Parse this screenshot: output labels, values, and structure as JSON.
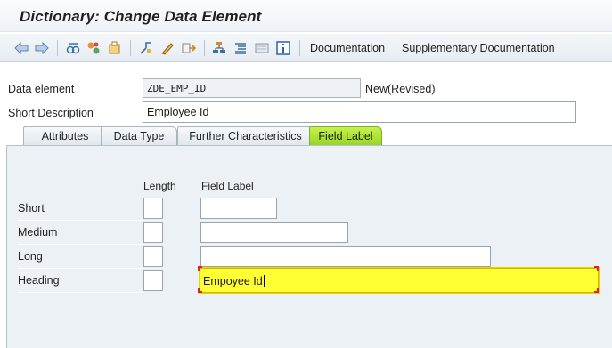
{
  "window": {
    "title": "Dictionary: Change Data Element"
  },
  "toolbar": {
    "icons": [
      "back-arrow-icon",
      "forward-arrow-icon",
      "other-object-icon",
      "display-change-icon",
      "activate-icon",
      "where-used-icon",
      "edit-object-icon",
      "navigate-icon",
      "hierarchy-icon",
      "indent-icon",
      "screen-icon",
      "info-icon"
    ],
    "documentation_label": "Documentation",
    "supplementary_label": "Supplementary Documentation"
  },
  "form": {
    "data_element_label": "Data element",
    "data_element_value": "ZDE_EMP_ID",
    "status": "New(Revised)",
    "short_description_label": "Short Description",
    "short_description_value": "Employee Id"
  },
  "tabs": [
    {
      "label": "Attributes",
      "active": false
    },
    {
      "label": "Data Type",
      "active": false
    },
    {
      "label": "Further Characteristics",
      "active": false
    },
    {
      "label": "Field Label",
      "active": true
    }
  ],
  "field_label_panel": {
    "length_header": "Length",
    "field_label_header": "Field Label",
    "rows": [
      {
        "label": "Short",
        "length": "",
        "value": ""
      },
      {
        "label": "Medium",
        "length": "",
        "value": ""
      },
      {
        "label": "Long",
        "length": "",
        "value": ""
      },
      {
        "label": "Heading",
        "length": "",
        "value": "Empoyee Id"
      }
    ]
  },
  "colors": {
    "active_tab": "#9bd32a",
    "focus_field": "#ffff33",
    "panel_bg": "#ecf1f6"
  }
}
